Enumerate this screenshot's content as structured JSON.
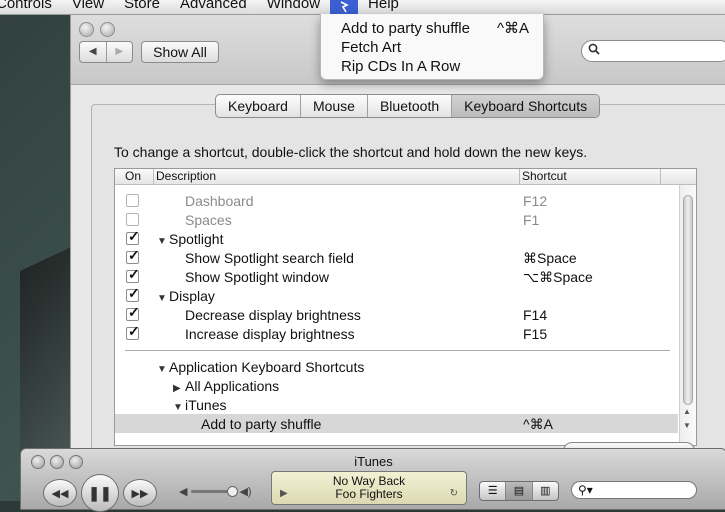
{
  "menubar": {
    "items": [
      "Controls",
      "View",
      "Store",
      "Advanced",
      "Window",
      "Help"
    ],
    "script_icon": "script-icon"
  },
  "dropdown": {
    "items": [
      {
        "label": "Add to party shuffle",
        "shortcut": "^⌘A"
      },
      {
        "label": "Fetch Art",
        "shortcut": ""
      },
      {
        "label": "Rip CDs In A Row",
        "shortcut": ""
      }
    ]
  },
  "toolbar": {
    "back": "◀",
    "forward": "▶",
    "show_all": "Show All",
    "search_icon": "magnifier-icon"
  },
  "tabs": [
    "Keyboard",
    "Mouse",
    "Bluetooth",
    "Keyboard Shortcuts"
  ],
  "instructions": "To change a shortcut, double-click the shortcut and hold down the new keys.",
  "table": {
    "headers": {
      "on": "On",
      "description": "Description",
      "shortcut": "Shortcut"
    },
    "rows": [
      {
        "checked": false,
        "dim": true,
        "label": "Dashboard",
        "shortcut": "F12"
      },
      {
        "checked": false,
        "dim": true,
        "label": "Spaces",
        "shortcut": "F1"
      },
      {
        "checked": true,
        "group": true,
        "label": "Spotlight",
        "shortcut": ""
      },
      {
        "checked": true,
        "label": "Show Spotlight search field",
        "shortcut": "⌘Space"
      },
      {
        "checked": true,
        "label": "Show Spotlight window",
        "shortcut": "⌥⌘Space"
      },
      {
        "checked": true,
        "group": true,
        "label": "Display",
        "shortcut": ""
      },
      {
        "checked": true,
        "label": "Decrease display brightness",
        "shortcut": "F14"
      },
      {
        "checked": true,
        "label": "Increase display brightness",
        "shortcut": "F15"
      }
    ],
    "app_section": {
      "title": "Application Keyboard Shortcuts",
      "all_apps": "All Applications",
      "itunes": "iTunes",
      "itunes_item": "Add to party shuffle",
      "itunes_item_shortcut": "^⌘A"
    }
  },
  "itunes": {
    "title": "iTunes",
    "song": "No Way Back",
    "artist": "Foo Fighters",
    "search_placeholder": ""
  }
}
